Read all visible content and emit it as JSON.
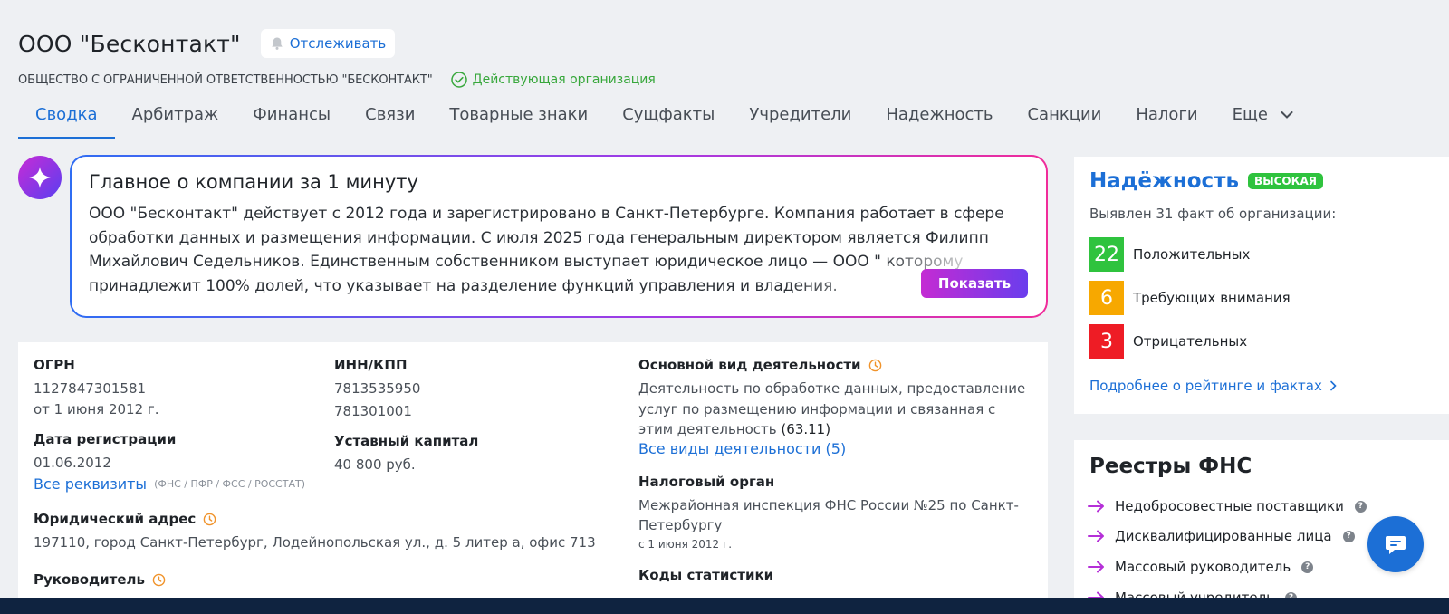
{
  "header": {
    "title": "ООО \"Бесконтакт\"",
    "track_label": "Отслеживать",
    "full_name": "ОБЩЕСТВО С ОГРАНИЧЕННОЙ ОТВЕТСТВЕННОСТЬЮ \"БЕСКОНТАКТ\"",
    "status": "Действующая организация"
  },
  "tabs": [
    {
      "label": "Сводка",
      "active": true
    },
    {
      "label": "Арбитраж"
    },
    {
      "label": "Финансы"
    },
    {
      "label": "Связи"
    },
    {
      "label": "Товарные знаки"
    },
    {
      "label": "Сущфакты"
    },
    {
      "label": "Учредители"
    },
    {
      "label": "Надежность"
    },
    {
      "label": "Санкции"
    },
    {
      "label": "Налоги"
    },
    {
      "label": "Еще"
    }
  ],
  "ai_summary": {
    "title": "Главное о компании за 1 минуту",
    "text": "ООО \"Бесконтакт\" действует с 2012 года и зарегистрировано в Санкт-Петербурге. Компания работает в сфере обработки данных и размещения информации. С июля 2025 года генеральным директором является Филипп Михайлович Седельников. Единственным собственником выступает юридическое лицо — ООО \" которому принадлежит 100% долей, что указывает на разделение функций управления и владения.",
    "show_label": "Показать"
  },
  "info": {
    "ogrn_label": "ОГРН",
    "ogrn_value": "1127847301581",
    "ogrn_date": "от 1 июня 2012 г.",
    "inn_label": "ИНН/КПП",
    "inn_value": "7813535950",
    "kpp_value": "781301001",
    "activity_label": "Основной вид деятельности",
    "activity_text": "Деятельность по обработке данных, предоставление услуг по размещению информации и связанная с этим деятельность",
    "activity_code": "(63.11)",
    "activity_all_link": "Все виды деятельности (5)",
    "reg_date_label": "Дата регистрации",
    "reg_date_value": "01.06.2012",
    "capital_label": "Уставный капитал",
    "capital_value": "40 800 руб.",
    "all_details_link": "Все реквизиты",
    "all_details_hint": "(ФНС / ПФР / ФСС / РОССТАТ)",
    "tax_label": "Налоговый орган",
    "tax_value": "Межрайонная инспекция ФНС России №25 по Санкт-Петербургу",
    "tax_date": "с 1 июня 2012 г.",
    "address_label": "Юридический адрес",
    "address_value": "197110, город Санкт-Петербург, Лодейнопольская ул., д. 5 литер а, офис 713",
    "head_label": "Руководитель",
    "stat_codes_label": "Коды статистики"
  },
  "reliability": {
    "title": "Надёжность",
    "badge": "ВЫСОКАЯ",
    "subtitle": "Выявлен 31 факт об организации:",
    "facts": [
      {
        "count": "22",
        "label": "Положительных",
        "color": "#2fc33e"
      },
      {
        "count": "6",
        "label": "Требующих внимания",
        "color": "#f7a800"
      },
      {
        "count": "3",
        "label": "Отрицательных",
        "color": "#ee1c25"
      }
    ],
    "more_link": "Подробнее о рейтинге и фактах"
  },
  "registers": {
    "title": "Реестры ФНС",
    "items": [
      "Недобросовестные поставщики",
      "Дисквалифицированные лица",
      "Массовый руководитель",
      "Массовый учредитель"
    ]
  }
}
